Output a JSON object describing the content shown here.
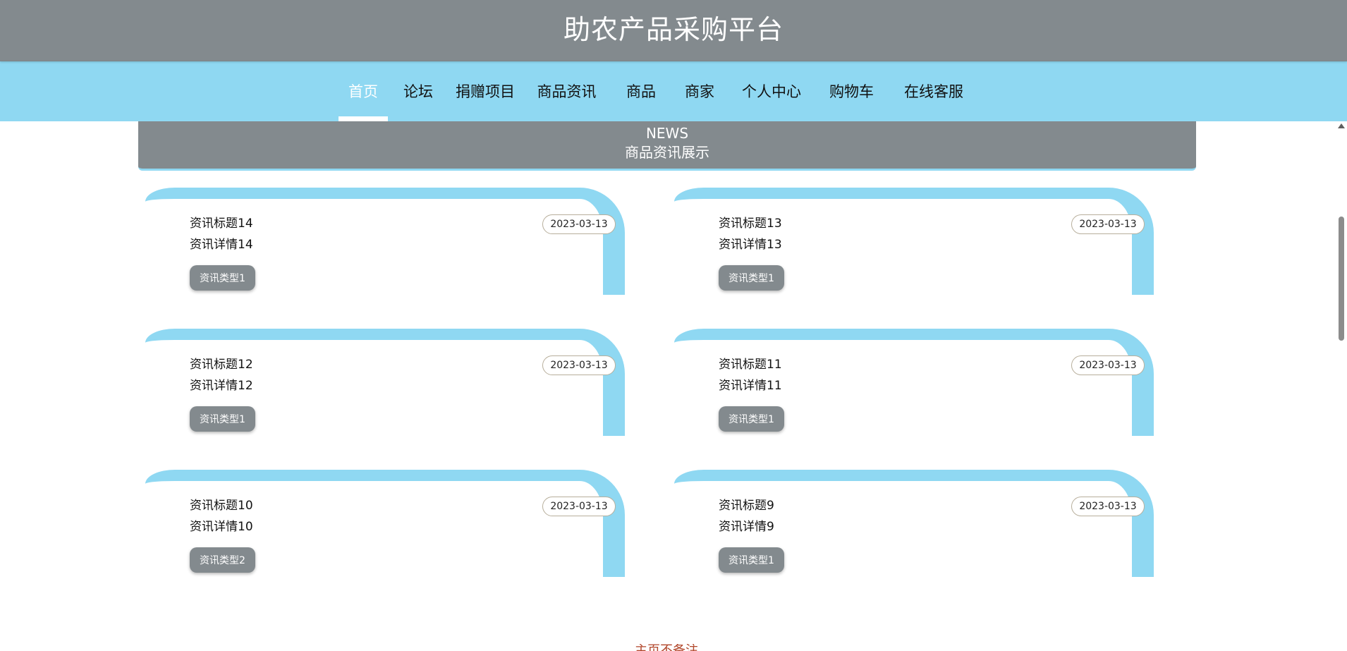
{
  "header": {
    "title": "助农产品采购平台"
  },
  "nav": {
    "items": [
      {
        "label": "首页",
        "active": true
      },
      {
        "label": "论坛"
      },
      {
        "label": "捐赠项目"
      },
      {
        "label": "商品资讯"
      },
      {
        "label": "商品"
      },
      {
        "label": "商家"
      },
      {
        "label": "个人中心"
      },
      {
        "label": "购物车"
      },
      {
        "label": "在线客服"
      }
    ]
  },
  "section": {
    "english_title": "NEWS",
    "chinese_title": "商品资讯展示"
  },
  "news": [
    {
      "title": "资讯标题14",
      "detail": "资讯详情14",
      "date": "2023-03-13",
      "type": "资讯类型1"
    },
    {
      "title": "资讯标题13",
      "detail": "资讯详情13",
      "date": "2023-03-13",
      "type": "资讯类型1"
    },
    {
      "title": "资讯标题12",
      "detail": "资讯详情12",
      "date": "2023-03-13",
      "type": "资讯类型1"
    },
    {
      "title": "资讯标题11",
      "detail": "资讯详情11",
      "date": "2023-03-13",
      "type": "资讯类型1"
    },
    {
      "title": "资讯标题10",
      "detail": "资讯详情10",
      "date": "2023-03-13",
      "type": "资讯类型2"
    },
    {
      "title": "资讯标题9",
      "detail": "资讯详情9",
      "date": "2023-03-13",
      "type": "资讯类型1"
    }
  ],
  "footer": {
    "note": "主页不备注"
  },
  "colors": {
    "header_gray": "#838a8e",
    "nav_blue": "#8fd8f2",
    "footer_red": "#b1462a"
  }
}
